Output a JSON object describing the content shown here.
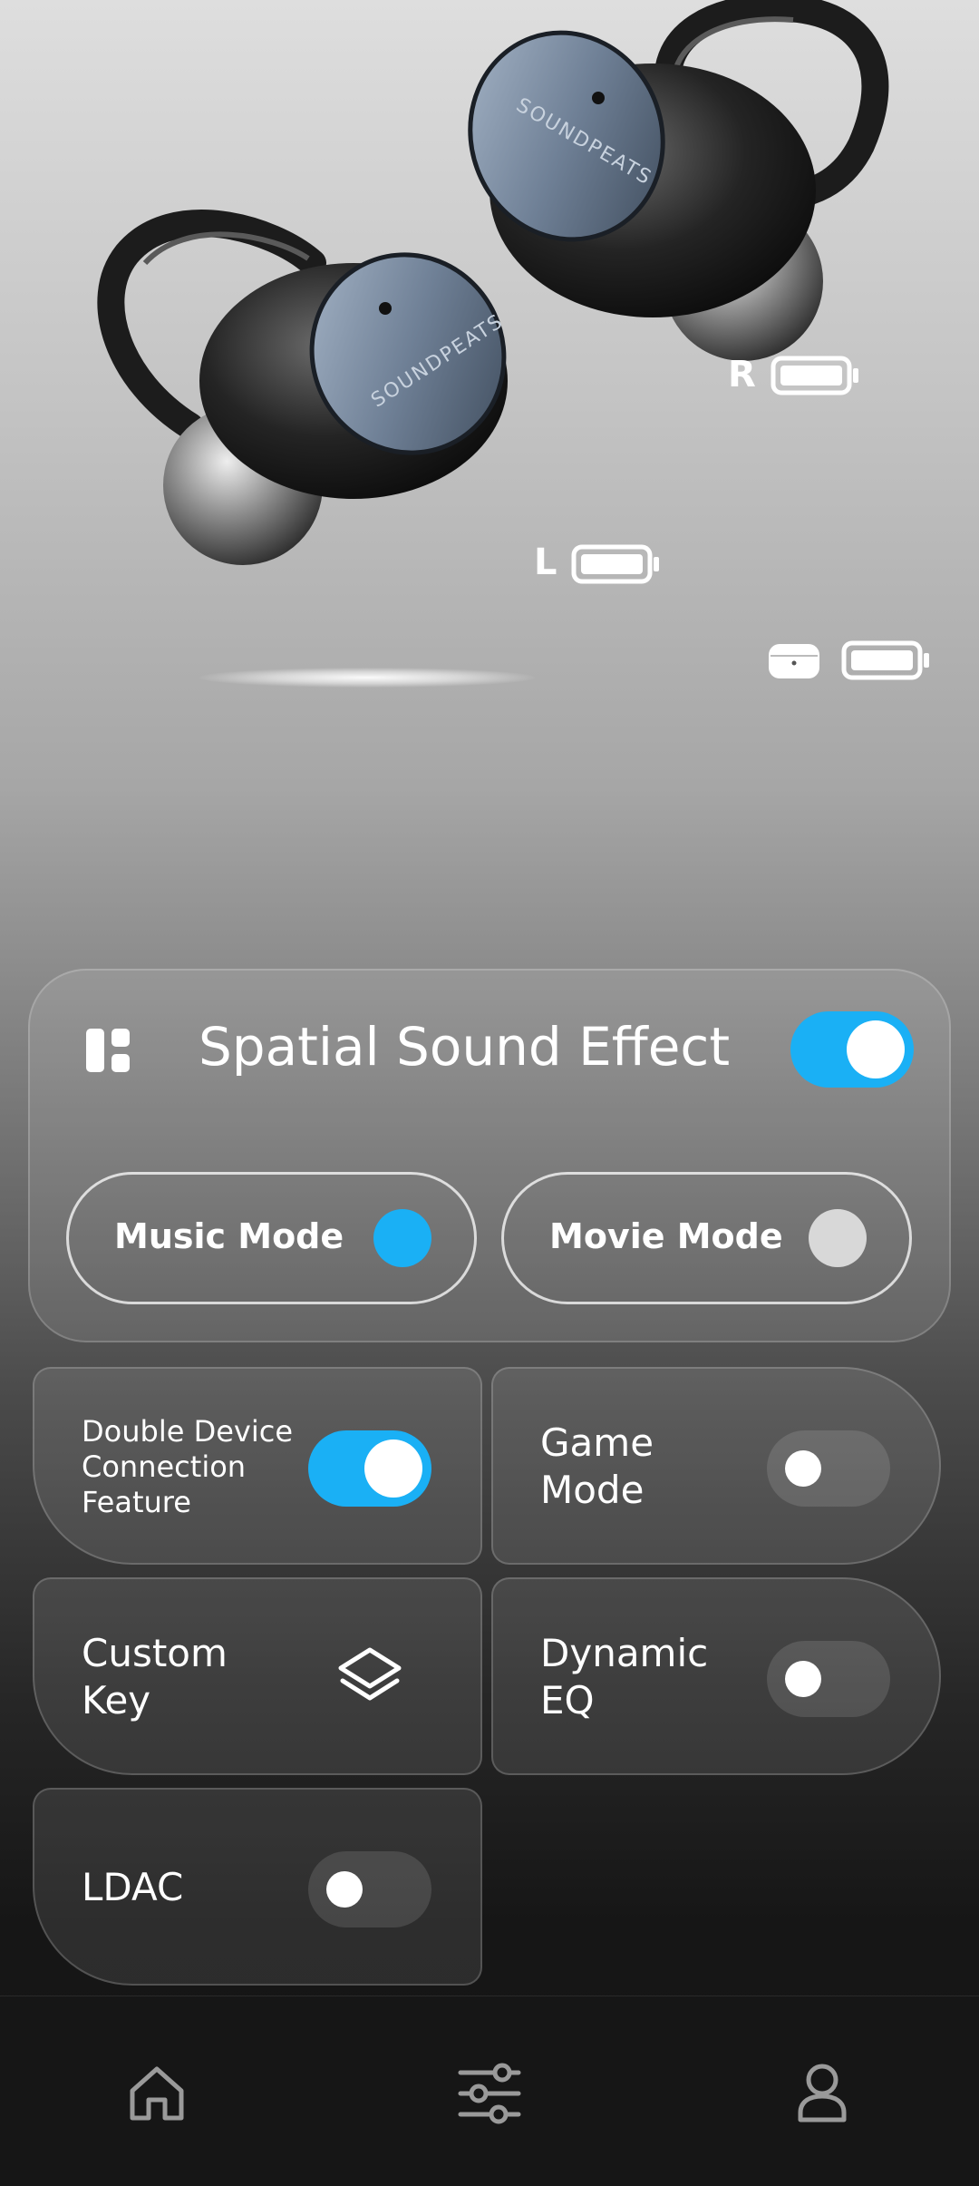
{
  "battery": {
    "right_label": "R",
    "left_label": "L"
  },
  "spatial": {
    "title": "Spatial Sound Effect",
    "enabled": true,
    "modes": [
      {
        "label": "Music Mode",
        "selected": true
      },
      {
        "label": "Movie Mode",
        "selected": false
      }
    ]
  },
  "features": {
    "double_device": {
      "label": "Double Device Connection Feature",
      "enabled": true
    },
    "game_mode": {
      "label": "Game Mode",
      "enabled": false
    },
    "custom_key": {
      "label": "Custom Key",
      "icon": "layers-icon"
    },
    "dynamic_eq": {
      "label": "Dynamic EQ",
      "enabled": false
    },
    "ldac": {
      "label": "LDAC",
      "enabled": false
    }
  },
  "nav": {
    "items": [
      {
        "icon": "home-icon"
      },
      {
        "icon": "equalizer-icon"
      },
      {
        "icon": "profile-icon"
      }
    ]
  },
  "colors": {
    "accent": "#1ab0f5",
    "dot_inactive": "#d8d8d8"
  }
}
